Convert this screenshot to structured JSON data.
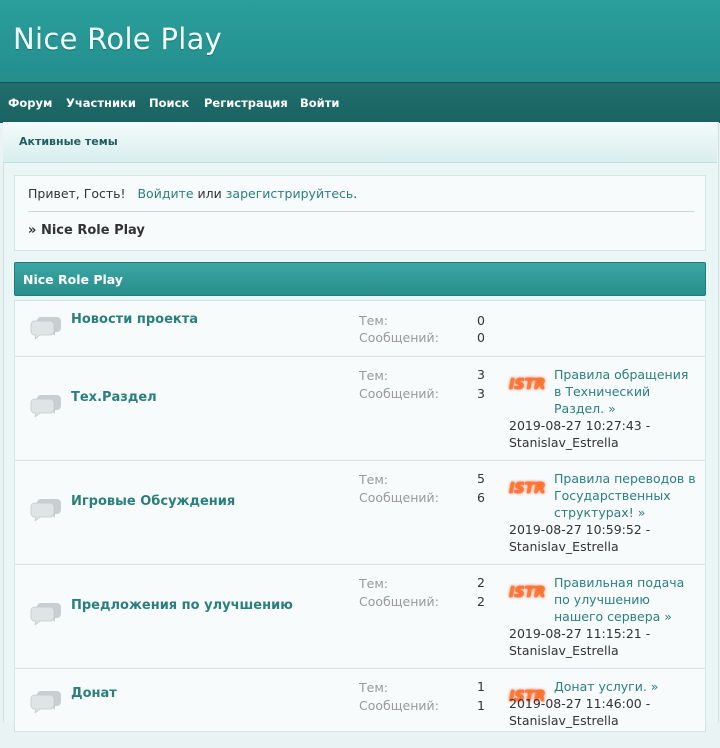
{
  "site": {
    "title": "Nice Role Play"
  },
  "nav": {
    "forum": "Форум",
    "users": "Участники",
    "search": "Поиск",
    "register": "Регистрация",
    "login": "Войти"
  },
  "subnav": {
    "active_topics": "Активные темы"
  },
  "welcome": {
    "greeting": "Привет, Гость!",
    "login_link": "Войдите",
    "or": "или",
    "register_link": "зарегистрируйтесь",
    "period": ".",
    "crumb_arrow": "»",
    "crumb": "Nice Role Play"
  },
  "category": {
    "title": "Nice Role Play"
  },
  "labels": {
    "topics": "Тем:",
    "posts": "Сообщений:"
  },
  "boards": [
    {
      "name": "Новости проекта",
      "topics": "0",
      "posts": "0"
    },
    {
      "name": "Тех.Раздел",
      "topics": "3",
      "posts": "3",
      "last_avatar": "ISTR",
      "last_title": "Правила обращения в Технический Раздел. »",
      "last_date": "2019-08-27 10:27:43 -",
      "last_author": "Stanislav_Estrella"
    },
    {
      "name": "Игровые Обсуждения",
      "topics": "5",
      "posts": "6",
      "last_avatar": "ISTR",
      "last_title": "Правила переводов в Государственных структурах! »",
      "last_date": "2019-08-27 10:59:52 -",
      "last_author": "Stanislav_Estrella"
    },
    {
      "name": "Предложения по улучшению",
      "topics": "2",
      "posts": "2",
      "last_avatar": "ISTR",
      "last_title": "Правильная подача по улучшению нашего сервера »",
      "last_date": "2019-08-27 11:15:21 -",
      "last_author": "Stanislav_Estrella"
    },
    {
      "name": "Донат",
      "topics": "1",
      "posts": "1",
      "last_avatar": "ISTR",
      "last_title": "Донат услуги. »",
      "last_date": "2019-08-27 11:46:00 -",
      "last_author": "Stanislav_Estrella"
    }
  ],
  "colors": {
    "header": "#2a9f9c",
    "navbar": "#1f6f6d",
    "link": "#2a7f7d",
    "category": "#3aa6a3"
  }
}
